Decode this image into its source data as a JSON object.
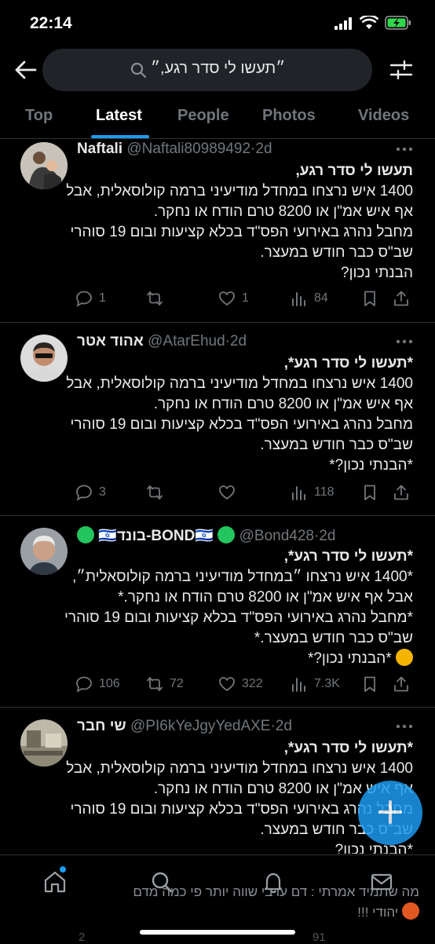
{
  "status_bar": {
    "time": "22:14"
  },
  "search": {
    "query": "״תעשו לי סדר רגע,״"
  },
  "tabs": [
    "Top",
    "Latest",
    "People",
    "Photos",
    "Videos"
  ],
  "active_tab": "Latest",
  "tweets": [
    {
      "name": "Naftali",
      "handle": "@Naftali80989492",
      "time": "2d",
      "lines": [
        "תעשו לי סדר רגע,",
        "1400 איש נרצחו במחדל מודיעיני ברמה קולוסאלית, אבל",
        "אף איש אמ\"ן או 8200 טרם הודח או נחקר.",
        "מחבל נהרג באירועי הפס\"ד בכלא קציעות ובום 19 סוהרי",
        "שב\"ס כבר חודש במעצר.",
        "הבנתי נכון?"
      ],
      "replies": "1",
      "retweets": "",
      "likes": "1",
      "views": "84"
    },
    {
      "name": "אהוד אטר",
      "handle": "@AtarEhud",
      "time": "2d",
      "lines": [
        "*תעשו לי סדר רגע*,",
        "1400 איש נרצחו במחדל מודיעיני ברמה קולוסאלית, אבל",
        "אף איש אמ\"ן או 8200 טרם הודח או נחקר.",
        "מחבל נהרג באירועי הפס\"ד בכלא קציעות ובום 19 סוהרי",
        "שב\"ס כבר חודש במעצר.",
        "*הבנתי נכון?*"
      ],
      "replies": "3",
      "retweets": "",
      "likes": "",
      "views": "118"
    },
    {
      "name": "🇮🇱בונד-BOND🇮🇱",
      "handle": "@Bond428",
      "time": "2d",
      "lines": [
        "*תעשו לי סדר רגע*,",
        "*1400 איש נרצחו ״במחדל מודיעיני ברמה קולוסאלית״,",
        "אבל אף איש אמ\"ן או 8200 טרם הודח או נחקר.*",
        "*מחבל נהרג באירועי הפס\"ד בכלא קציעות ובום 19 סוהרי",
        "שב\"ס כבר חודש במעצר.*",
        "*הבנתי נכון?*"
      ],
      "replies": "106",
      "retweets": "72",
      "likes": "322",
      "views": "7.3K"
    },
    {
      "name": "שי חבר",
      "handle": "@PI6kYeJgyYedAXE",
      "time": "2d",
      "lines": [
        "*תעשו לי סדר רגע*,",
        "1400 איש נרצחו במחדל מודיעיני ברמה קולוסאלית, אבל",
        "אף איש אמ\"ן או 8200 טרם הודח או נחקר.",
        "מחבל נהרג באירועי הפס\"ד בכלא קציעות ובום 19 סוהרי",
        "שב\"ס כבר חודש במעצר.",
        "*הבנתי נכון?"
      ],
      "replies": "2",
      "retweets": "",
      "likes": "",
      "views": "91"
    }
  ],
  "overlay_text": [
    "מה שתמיד אמרתי : דם ערבי שווה יותר פי כמה מדם",
    "יהודי !!!"
  ],
  "colors": {
    "accent": "#1d9bf0",
    "muted": "#71767b",
    "bond_dot": "#22c55e"
  }
}
